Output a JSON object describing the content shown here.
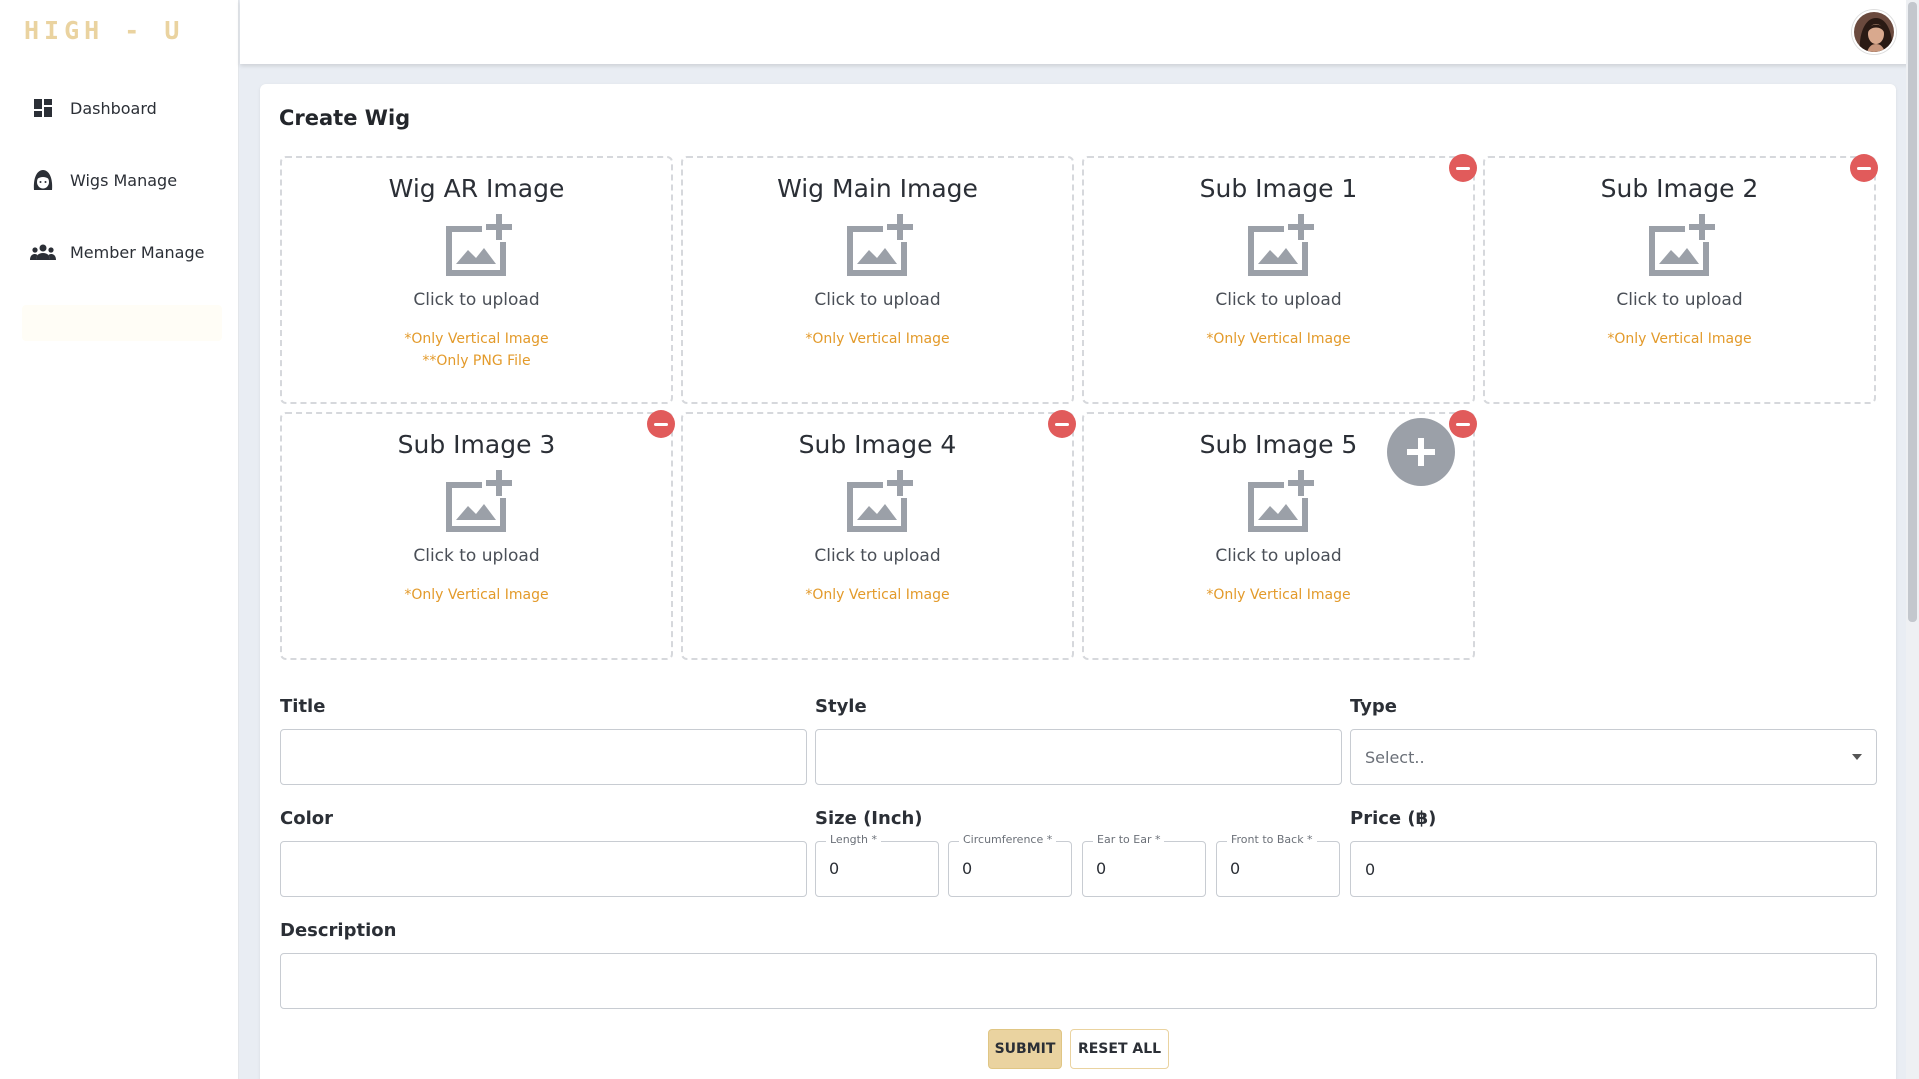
{
  "app": {
    "logo": "HIGH - U"
  },
  "sidebar": {
    "items": [
      {
        "label": "Dashboard",
        "icon": "dashboard-icon"
      },
      {
        "label": "Wigs Manage",
        "icon": "wig-icon"
      },
      {
        "label": "Member Manage",
        "icon": "members-icon"
      }
    ]
  },
  "header": {
    "avatar": "user-avatar"
  },
  "page": {
    "title": "Create Wig"
  },
  "uploads": {
    "tiles": [
      {
        "title": "Wig AR Image",
        "upload_label": "Click to upload",
        "note1": "*Only Vertical Image",
        "note2": "**Only PNG File",
        "removable": false
      },
      {
        "title": "Wig Main Image",
        "upload_label": "Click to upload",
        "note1": "*Only Vertical Image",
        "removable": false
      },
      {
        "title": "Sub Image 1",
        "upload_label": "Click to upload",
        "note1": "*Only Vertical Image",
        "removable": true
      },
      {
        "title": "Sub Image 2",
        "upload_label": "Click to upload",
        "note1": "*Only Vertical Image",
        "removable": true
      },
      {
        "title": "Sub Image 3",
        "upload_label": "Click to upload",
        "note1": "*Only Vertical Image",
        "removable": true
      },
      {
        "title": "Sub Image 4",
        "upload_label": "Click to upload",
        "note1": "*Only Vertical Image",
        "removable": true
      },
      {
        "title": "Sub Image 5",
        "upload_label": "Click to upload",
        "note1": "*Only Vertical Image",
        "removable": true
      }
    ]
  },
  "form": {
    "title": {
      "label": "Title",
      "value": ""
    },
    "style": {
      "label": "Style",
      "value": ""
    },
    "type": {
      "label": "Type",
      "placeholder": "Select.."
    },
    "color": {
      "label": "Color",
      "value": ""
    },
    "size": {
      "label": "Size (Inch)",
      "length": {
        "label": "Length *",
        "value": "0"
      },
      "circumference": {
        "label": "Circumference *",
        "value": "0"
      },
      "ear_to_ear": {
        "label": "Ear to Ear *",
        "value": "0"
      },
      "front_to_back": {
        "label": "Front to Back *",
        "value": "0"
      }
    },
    "price": {
      "label": "Price (฿)",
      "value": "0"
    },
    "description": {
      "label": "Description",
      "value": ""
    }
  },
  "actions": {
    "submit_label": "SUBMIT",
    "reset_label": "RESET ALL"
  },
  "colors": {
    "accent": "#ead3a0",
    "danger": "#e15b5b",
    "note": "#e39a2a"
  }
}
